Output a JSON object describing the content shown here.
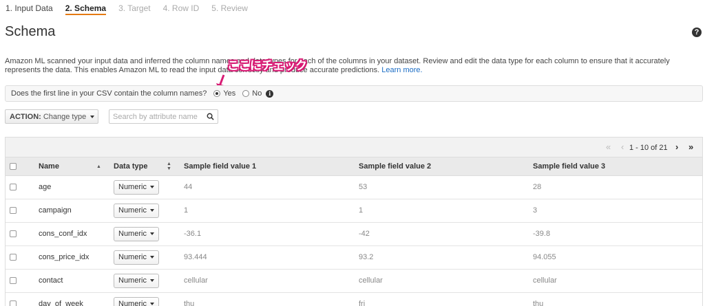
{
  "steps": [
    {
      "label": "1. Input Data",
      "state": "done"
    },
    {
      "label": "2. Schema",
      "state": "active"
    },
    {
      "label": "3. Target",
      "state": "disabled"
    },
    {
      "label": "4. Row ID",
      "state": "disabled"
    },
    {
      "label": "5. Review",
      "state": "disabled"
    }
  ],
  "page_title": "Schema",
  "help_icon": "?",
  "description": {
    "line1": "Amazon ML scanned your input data and inferred the column names and data types for each of the columns in your dataset. Review and edit the data type for each column to ensure that it accurately",
    "line2": "represents the data. This enables Amazon ML to read the input data correctly and produce accurate predictions.",
    "link": "Learn more."
  },
  "callout": {
    "text": "ここにチェック",
    "color": "#d81b74"
  },
  "question": {
    "text": "Does the first line in your CSV contain the column names?",
    "options": [
      {
        "label": "Yes",
        "checked": true
      },
      {
        "label": "No",
        "checked": false
      }
    ],
    "info_icon": "i"
  },
  "action": {
    "prefix": "ACTION:",
    "label": "Change type"
  },
  "search": {
    "placeholder": "Search by attribute name"
  },
  "pager": {
    "first": "«",
    "prev": "‹",
    "range": "1 - 10 of 21",
    "next": "›",
    "last": "»"
  },
  "table": {
    "headers": {
      "name": "Name",
      "data_type": "Data type",
      "s1": "Sample field value 1",
      "s2": "Sample field value 2",
      "s3": "Sample field value 3"
    },
    "rows": [
      {
        "name": "age",
        "type": "Numeric",
        "s1": "44",
        "s2": "53",
        "s3": "28"
      },
      {
        "name": "campaign",
        "type": "Numeric",
        "s1": "1",
        "s2": "1",
        "s3": "3"
      },
      {
        "name": "cons_conf_idx",
        "type": "Numeric",
        "s1": "-36.1",
        "s2": "-42",
        "s3": "-39.8"
      },
      {
        "name": "cons_price_idx",
        "type": "Numeric",
        "s1": "93.444",
        "s2": "93.2",
        "s3": "94.055"
      },
      {
        "name": "contact",
        "type": "Numeric",
        "s1": "cellular",
        "s2": "cellular",
        "s3": "cellular"
      },
      {
        "name": "day_of_week",
        "type": "Numeric",
        "s1": "thu",
        "s2": "fri",
        "s3": "thu"
      }
    ]
  }
}
